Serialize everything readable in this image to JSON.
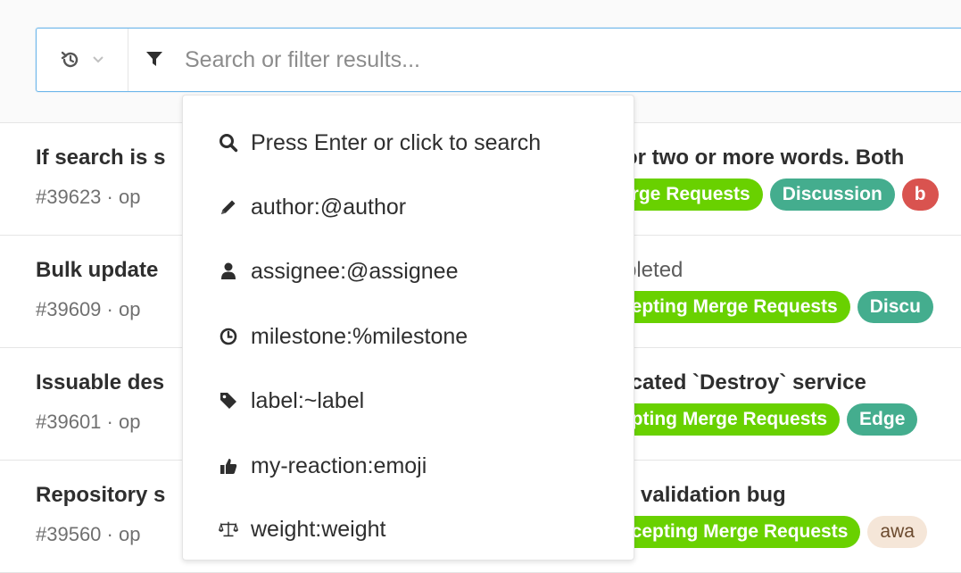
{
  "search": {
    "placeholder": "Search or filter results..."
  },
  "issues": [
    {
      "title_left": "If search is s",
      "title_right": "or two or more words. Both",
      "title_right_muted": false,
      "meta": "#39623 · op",
      "labels": [
        {
          "text": "erge Requests",
          "color": "#69d100"
        },
        {
          "text": "Discussion",
          "color": "#44ad8e"
        },
        {
          "text": "b",
          "color": "#d9534f"
        }
      ]
    },
    {
      "title_left": "Bulk update",
      "title_right": "pleted",
      "title_right_muted": true,
      "meta": "#39609 · op",
      "labels": [
        {
          "text": "cepting Merge Requests",
          "color": "#69d100"
        },
        {
          "text": "Discu",
          "color": "#44ad8e"
        }
      ]
    },
    {
      "title_left": "Issuable des",
      "title_right": "icated `Destroy` service",
      "title_right_muted": false,
      "meta": "#39601 · op",
      "labels": [
        {
          "text": "epting Merge Requests",
          "color": "#69d100"
        },
        {
          "text": "Edge",
          "color": "#44ad8e"
        }
      ]
    },
    {
      "title_left": "Repository s",
      "title_right": "\" validation bug",
      "title_right_muted": false,
      "meta": "#39560 · op",
      "labels": [
        {
          "text": "ccepting Merge Requests",
          "color": "#69d100"
        },
        {
          "text": "awa",
          "color": "#f5e6d8",
          "text_color": "#6b4a2e"
        }
      ]
    }
  ],
  "dropdown": {
    "items": [
      {
        "icon": "search-icon",
        "text": "Press Enter or click to search"
      },
      {
        "icon": "pencil-icon",
        "text": "author:@author"
      },
      {
        "icon": "user-icon",
        "text": "assignee:@assignee"
      },
      {
        "icon": "clock-icon",
        "text": "milestone:%milestone"
      },
      {
        "icon": "tag-icon",
        "text": "label:~label"
      },
      {
        "icon": "thumbs-up-icon",
        "text": "my-reaction:emoji"
      },
      {
        "icon": "balance-scale-icon",
        "text": "weight:weight"
      }
    ]
  }
}
